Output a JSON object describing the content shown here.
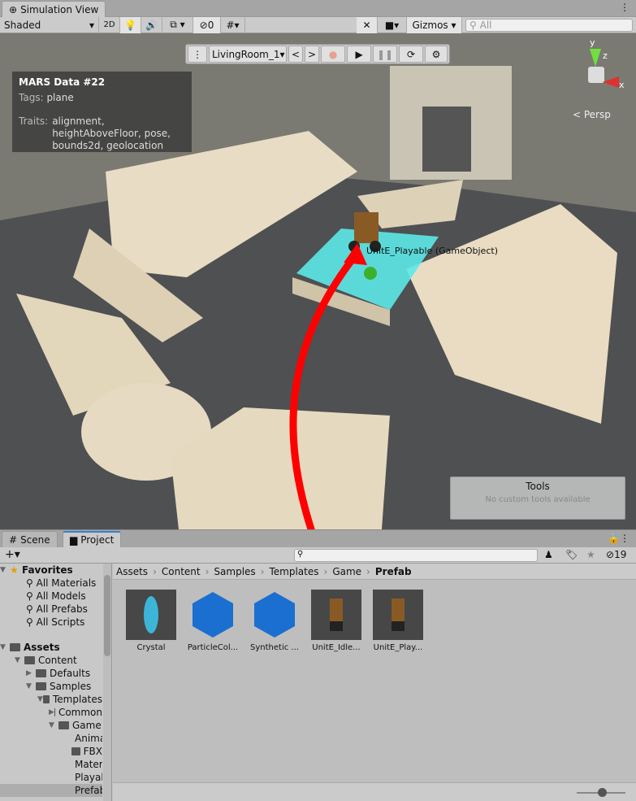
{
  "window": {
    "tab_title": "Simulation View"
  },
  "toolbar": {
    "shading_mode": "Shaded",
    "mode_2d": "2D",
    "hidden_count": "0",
    "gizmos": "Gizmos",
    "search_placeholder": "All"
  },
  "overlay": {
    "environment": "LivingRoom_1",
    "prev": "<",
    "next": ">"
  },
  "mars_panel": {
    "title": "MARS Data #22",
    "tags_label": "Tags:",
    "tags_value": "plane",
    "traits_label": "Traits:",
    "traits_value": "alignment, heightAboveFloor, pose, bounds2d, geolocation"
  },
  "scene": {
    "drag_label": "UnitE_Playable (GameObject)",
    "persp_label": "< Persp",
    "gizmo_axes": [
      "y",
      "z",
      "x"
    ],
    "arrow_color": "#ff0000",
    "highlight_color": "#5de8e8"
  },
  "tools_panel": {
    "title": "Tools",
    "message": "No custom tools available"
  },
  "bottom_tabs": [
    {
      "label": "Scene"
    },
    {
      "label": "Project"
    }
  ],
  "project": {
    "hidden_count": "19",
    "favorites": {
      "label": "Favorites",
      "items": [
        "All Materials",
        "All Models",
        "All Prefabs",
        "All Scripts"
      ]
    },
    "tree": [
      {
        "label": "Assets",
        "depth": 0,
        "state": "open"
      },
      {
        "label": "Content",
        "depth": 1,
        "state": "open"
      },
      {
        "label": "Defaults",
        "depth": 2,
        "state": "closed"
      },
      {
        "label": "Samples",
        "depth": 2,
        "state": "open"
      },
      {
        "label": "Templates",
        "depth": 3,
        "state": "open"
      },
      {
        "label": "Common",
        "depth": 4,
        "state": "closed"
      },
      {
        "label": "Game",
        "depth": 4,
        "state": "open"
      },
      {
        "label": "Animations",
        "depth": 5,
        "state": "none"
      },
      {
        "label": "FBX",
        "depth": 5,
        "state": "none"
      },
      {
        "label": "Materials",
        "depth": 5,
        "state": "none"
      },
      {
        "label": "Playables",
        "depth": 5,
        "state": "none"
      },
      {
        "label": "Prefab",
        "depth": 5,
        "state": "none",
        "selected": true
      }
    ],
    "breadcrumb": [
      "Assets",
      "Content",
      "Samples",
      "Templates",
      "Game",
      "Prefab"
    ],
    "assets": [
      {
        "name": "Crystal",
        "icon": "crystal-thumbnail"
      },
      {
        "name": "ParticleCol...",
        "icon": "prefab-cube-icon"
      },
      {
        "name": "Synthetic ...",
        "icon": "prefab-cube-icon"
      },
      {
        "name": "UnitE_Idle...",
        "icon": "robot-thumbnail"
      },
      {
        "name": "UnitE_Play...",
        "icon": "robot-thumbnail"
      }
    ]
  }
}
